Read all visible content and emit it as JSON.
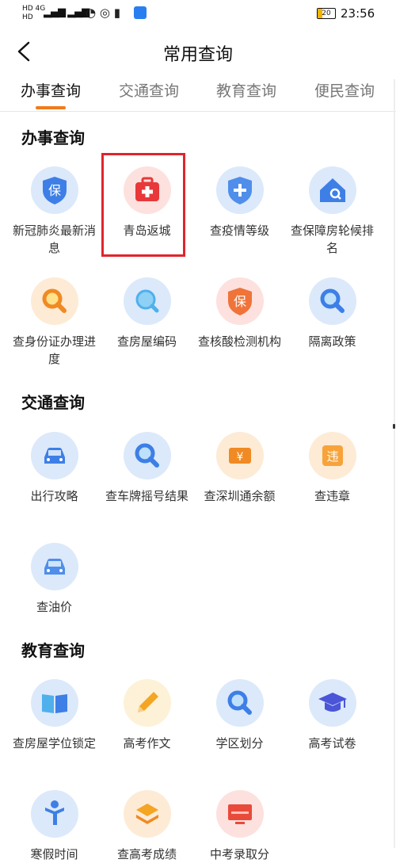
{
  "status_bar": {
    "signal_top": "HD 4G",
    "signal_bottom": "HD",
    "battery_level": "20",
    "time": "23:56"
  },
  "header": {
    "title": "常用查询",
    "back_icon": "chevron-left-icon"
  },
  "tabs": [
    {
      "label": "办事查询",
      "active": true
    },
    {
      "label": "交通查询",
      "active": false
    },
    {
      "label": "教育查询",
      "active": false
    },
    {
      "label": "便民查询",
      "active": false
    }
  ],
  "sections": {
    "banshi": {
      "title": "办事查询",
      "items": [
        {
          "label": "新冠肺炎最新消息",
          "icon": "shield-bao-icon"
        },
        {
          "label": "青岛返城",
          "icon": "first-aid-kit-icon"
        },
        {
          "label": "查疫情等级",
          "icon": "shield-plus-icon"
        },
        {
          "label": "查保障房轮候排名",
          "icon": "house-search-icon"
        },
        {
          "label": "查身份证办理进度",
          "icon": "magnifier-icon"
        },
        {
          "label": "查房屋编码",
          "icon": "magnifier-icon"
        },
        {
          "label": "查核酸检测机构",
          "icon": "shield-bao-icon"
        },
        {
          "label": "隔离政策",
          "icon": "magnifier-icon"
        }
      ]
    },
    "jiaotong": {
      "title": "交通查询",
      "items": [
        {
          "label": "出行攻略",
          "icon": "car-icon"
        },
        {
          "label": "查车牌摇号结果",
          "icon": "magnifier-icon"
        },
        {
          "label": "查深圳通余额",
          "icon": "yuan-card-icon"
        },
        {
          "label": "查违章",
          "icon": "violation-icon"
        },
        {
          "label": "查油价",
          "icon": "car-icon"
        }
      ]
    },
    "jiaoyu": {
      "title": "教育查询",
      "items": [
        {
          "label": "查房屋学位锁定",
          "icon": "book-icon"
        },
        {
          "label": "高考作文",
          "icon": "pencil-icon"
        },
        {
          "label": "学区划分",
          "icon": "magnifier-icon"
        },
        {
          "label": "高考试卷",
          "icon": "graduation-cap-icon"
        },
        {
          "label": "寒假时间",
          "icon": "person-icon"
        },
        {
          "label": "查高考成绩",
          "icon": "layers-icon"
        },
        {
          "label": "中考录取分",
          "icon": "monitor-icon"
        }
      ]
    }
  },
  "glyphs": {
    "bao": "保",
    "wei": "违",
    "yuan": "¥"
  },
  "colors": {
    "accent": "#f07b1d",
    "highlight_box": "#e0252b",
    "icon_blue": "#3d7fe6",
    "icon_orange": "#f08a24",
    "icon_red": "#e84b3a"
  }
}
